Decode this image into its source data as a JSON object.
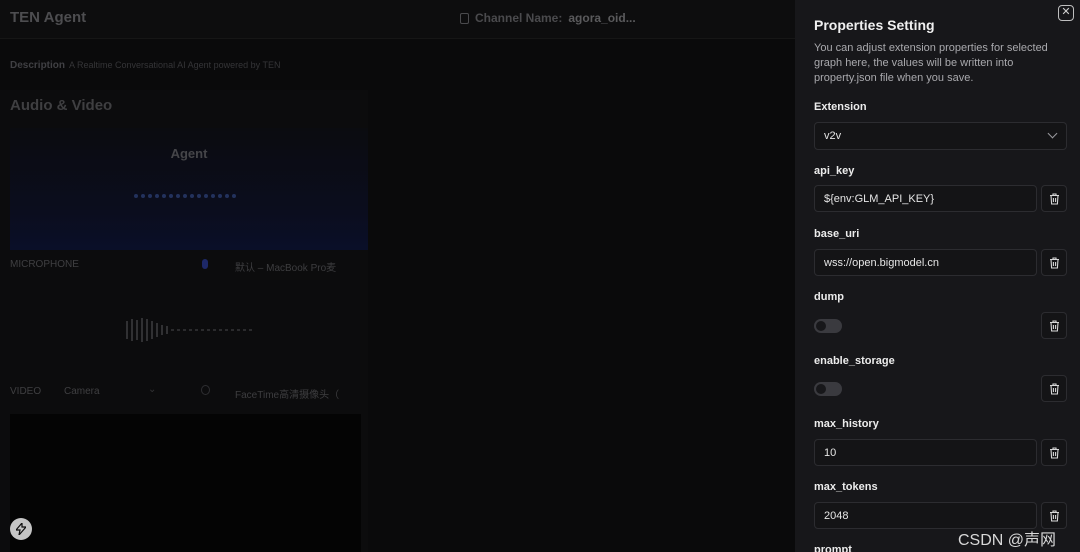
{
  "app": {
    "title": "TEN Agent",
    "channel_label": "Channel Name:",
    "channel_value": "agora_oid...",
    "description_label": "Description",
    "description_text": "A Realtime Conversational AI Agent powered by TEN"
  },
  "av": {
    "section_title": "Audio & Video",
    "agent_label": "Agent",
    "microphone_label": "MICROPHONE",
    "microphone_device": "默认 – MacBook Pro麦",
    "video_label": "VIDEO",
    "video_source": "Camera",
    "video_device": "FaceTime高清摄像头（"
  },
  "settings": {
    "title": "Properties Setting",
    "subtitle": "You can adjust extension properties for selected graph here, the values will be written into property.json file when you save.",
    "extension_label": "Extension",
    "extension_value": "v2v",
    "fields": [
      {
        "label": "api_key",
        "type": "text",
        "value": "${env:GLM_API_KEY}"
      },
      {
        "label": "base_uri",
        "type": "text",
        "value": "wss://open.bigmodel.cn"
      },
      {
        "label": "dump",
        "type": "toggle",
        "value": false
      },
      {
        "label": "enable_storage",
        "type": "toggle",
        "value": false
      },
      {
        "label": "max_history",
        "type": "text",
        "value": "10"
      },
      {
        "label": "max_tokens",
        "type": "text",
        "value": "2048"
      },
      {
        "label": "prompt",
        "type": "text",
        "value": ""
      }
    ]
  },
  "watermark": "CSDN @声网",
  "icons": {
    "close": "close-icon",
    "trash": "trash-icon",
    "chevron": "chevron-down-icon",
    "bolt": "bolt-icon"
  }
}
